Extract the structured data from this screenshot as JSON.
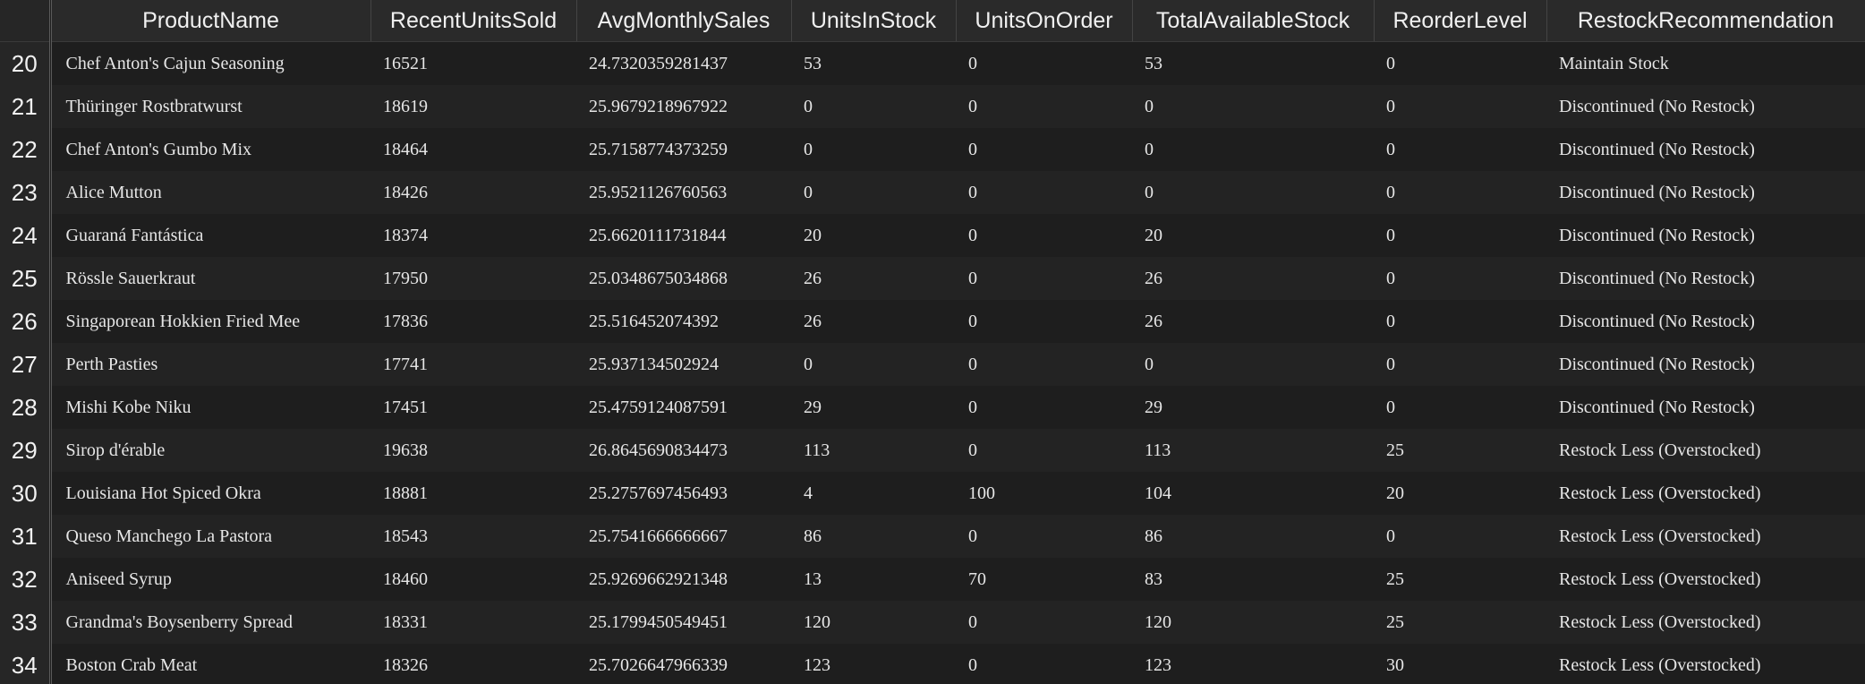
{
  "columns": [
    "ProductName",
    "RecentUnitsSold",
    "AvgMonthlySales",
    "UnitsInStock",
    "UnitsOnOrder",
    "TotalAvailableStock",
    "ReorderLevel",
    "RestockRecommendation"
  ],
  "rows": [
    {
      "idx": "20",
      "cells": [
        "Chef Anton's Cajun Seasoning",
        "16521",
        "24.7320359281437",
        "53",
        "0",
        "53",
        "0",
        "Maintain Stock"
      ]
    },
    {
      "idx": "21",
      "cells": [
        "Thüringer Rostbratwurst",
        "18619",
        "25.9679218967922",
        "0",
        "0",
        "0",
        "0",
        "Discontinued (No Restock)"
      ]
    },
    {
      "idx": "22",
      "cells": [
        "Chef Anton's Gumbo Mix",
        "18464",
        "25.7158774373259",
        "0",
        "0",
        "0",
        "0",
        "Discontinued (No Restock)"
      ]
    },
    {
      "idx": "23",
      "cells": [
        "Alice Mutton",
        "18426",
        "25.9521126760563",
        "0",
        "0",
        "0",
        "0",
        "Discontinued (No Restock)"
      ]
    },
    {
      "idx": "24",
      "cells": [
        "Guaraná Fantástica",
        "18374",
        "25.6620111731844",
        "20",
        "0",
        "20",
        "0",
        "Discontinued (No Restock)"
      ]
    },
    {
      "idx": "25",
      "cells": [
        "Rössle Sauerkraut",
        "17950",
        "25.0348675034868",
        "26",
        "0",
        "26",
        "0",
        "Discontinued (No Restock)"
      ]
    },
    {
      "idx": "26",
      "cells": [
        "Singaporean Hokkien Fried Mee",
        "17836",
        "25.516452074392",
        "26",
        "0",
        "26",
        "0",
        "Discontinued (No Restock)"
      ]
    },
    {
      "idx": "27",
      "cells": [
        "Perth Pasties",
        "17741",
        "25.937134502924",
        "0",
        "0",
        "0",
        "0",
        "Discontinued (No Restock)"
      ]
    },
    {
      "idx": "28",
      "cells": [
        "Mishi Kobe Niku",
        "17451",
        "25.4759124087591",
        "29",
        "0",
        "29",
        "0",
        "Discontinued (No Restock)"
      ]
    },
    {
      "idx": "29",
      "cells": [
        "Sirop d'érable",
        "19638",
        "26.8645690834473",
        "113",
        "0",
        "113",
        "25",
        "Restock Less (Overstocked)"
      ]
    },
    {
      "idx": "30",
      "cells": [
        "Louisiana Hot Spiced Okra",
        "18881",
        "25.2757697456493",
        "4",
        "100",
        "104",
        "20",
        "Restock Less (Overstocked)"
      ]
    },
    {
      "idx": "31",
      "cells": [
        "Queso Manchego La Pastora",
        "18543",
        "25.7541666666667",
        "86",
        "0",
        "86",
        "0",
        "Restock Less (Overstocked)"
      ]
    },
    {
      "idx": "32",
      "cells": [
        "Aniseed Syrup",
        "18460",
        "25.9269662921348",
        "13",
        "70",
        "83",
        "25",
        "Restock Less (Overstocked)"
      ]
    },
    {
      "idx": "33",
      "cells": [
        "Grandma's Boysenberry Spread",
        "18331",
        "25.1799450549451",
        "120",
        "0",
        "120",
        "25",
        "Restock Less (Overstocked)"
      ]
    },
    {
      "idx": "34",
      "cells": [
        "Boston Crab Meat",
        "18326",
        "25.7026647966339",
        "123",
        "0",
        "123",
        "30",
        "Restock Less (Overstocked)"
      ]
    }
  ]
}
